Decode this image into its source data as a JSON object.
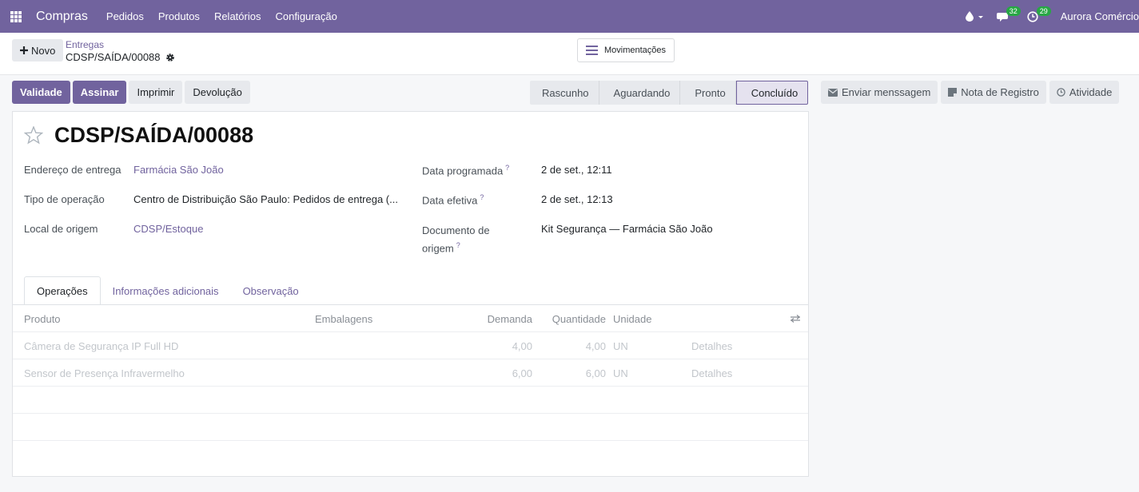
{
  "navbar": {
    "brand": "Compras",
    "menu": [
      "Pedidos",
      "Produtos",
      "Relatórios",
      "Configuração"
    ],
    "messages_count": "32",
    "activities_count": "29",
    "user": "Aurora Comércio"
  },
  "control": {
    "new_label": "Novo",
    "breadcrumb_parent": "Entregas",
    "breadcrumb_current": "CDSP/SAÍDA/00088",
    "moves_label": "Movimentações"
  },
  "actions": [
    "Validade",
    "Assinar",
    "Imprimir",
    "Devolução"
  ],
  "stages": [
    "Rascunho",
    "Aguardando",
    "Pronto",
    "Concluído"
  ],
  "chatter": {
    "send_message": "Enviar menssagem",
    "log_note": "Nota de Registro",
    "activity": "Atividade"
  },
  "record": {
    "title": "CDSP/SAÍDA/00088",
    "fields": {
      "delivery_address_label": "Endereço de entrega",
      "delivery_address": "Farmácia São João",
      "operation_type_label": "Tipo de operação",
      "operation_type": "Centro de Distribuição São Paulo: Pedidos de entrega (...",
      "source_location_label": "Local de origem",
      "source_location": "CDSP/Estoque",
      "scheduled_date_label": "Data programada",
      "scheduled_date": "2 de set., 12:11",
      "effective_date_label": "Data efetiva",
      "effective_date": "2 de set., 12:13",
      "source_document_label_1": "Documento de",
      "source_document_label_2": "origem",
      "source_document": "Kit Segurança — Farmácia São João",
      "help_mark": "?"
    }
  },
  "tabs": [
    "Operações",
    "Informações adicionais",
    "Observação"
  ],
  "table": {
    "headers": [
      "Produto",
      "Embalagens",
      "Demanda",
      "Quantidade",
      "Unidade"
    ],
    "rows": [
      {
        "product": "Câmera de Segurança IP Full HD",
        "demand": "4,00",
        "quantity": "4,00",
        "unit": "UN",
        "details": "Detalhes"
      },
      {
        "product": "Sensor de Presença Infravermelho",
        "demand": "6,00",
        "quantity": "6,00",
        "unit": "UN",
        "details": "Detalhes"
      }
    ]
  }
}
